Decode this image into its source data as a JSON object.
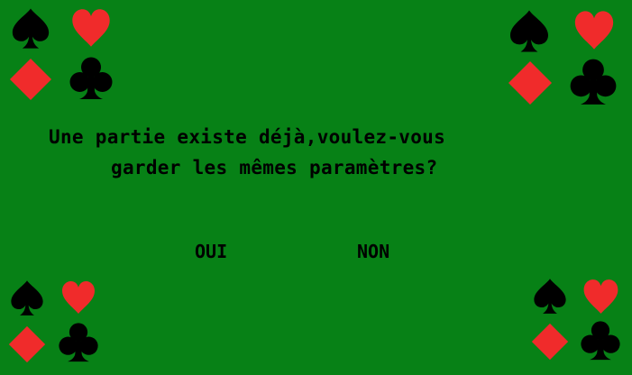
{
  "dialog": {
    "question_line_1": "Une partie existe déjà,voulez-vous",
    "question_line_2": "garder les mêmes paramètres?",
    "yes_label": "OUI",
    "no_label": "NON"
  },
  "icons": {
    "spade": "spade-icon",
    "heart": "heart-icon",
    "diamond": "diamond-icon",
    "club": "club-icon"
  },
  "colors": {
    "background": "#078116",
    "text": "#000000",
    "red_suit": "#f02b2b",
    "black_suit": "#000000"
  }
}
